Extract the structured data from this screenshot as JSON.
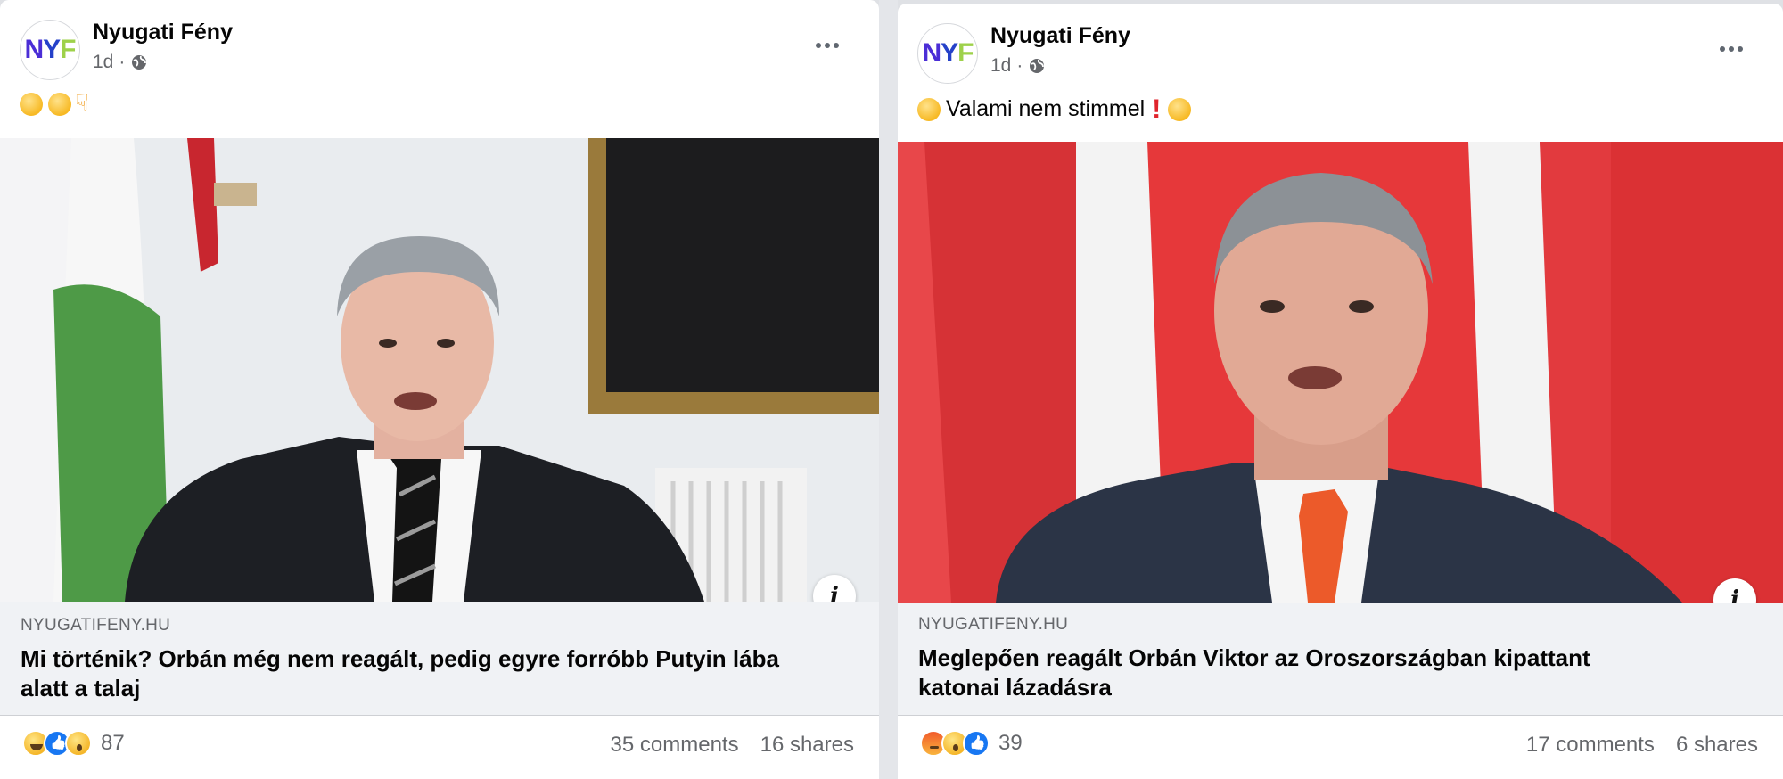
{
  "posts": [
    {
      "page_name": "Nyugati Fény",
      "avatar": {
        "n": "N",
        "y": "Y",
        "f": "F"
      },
      "time": "1d",
      "separator": "·",
      "caption_text": "",
      "link": {
        "domain": "NYUGATIFENY.HU",
        "headline_line1": "Mi történik? Orbán még nem reagált, pedig egyre forróbb Putyin lába",
        "headline_line2": "alatt a talaj"
      },
      "reaction_count": "87",
      "comments": "35 comments",
      "shares": "16 shares"
    },
    {
      "page_name": "Nyugati Fény",
      "avatar": {
        "n": "N",
        "y": "Y",
        "f": "F"
      },
      "time": "1d",
      "separator": "·",
      "caption_text": "Valami nem stimmel",
      "link": {
        "domain": "NYUGATIFENY.HU",
        "headline_line1": "Meglepően reagált Orbán Viktor az Oroszországban kipattant",
        "headline_line2": "katonai lázadásra"
      },
      "reaction_count": "39",
      "comments": "17 comments",
      "shares": "6 shares"
    }
  ],
  "colors": {
    "brand_blue": "#1877f2",
    "text_secondary": "#65676b",
    "link_box_bg": "#f0f2f5"
  }
}
